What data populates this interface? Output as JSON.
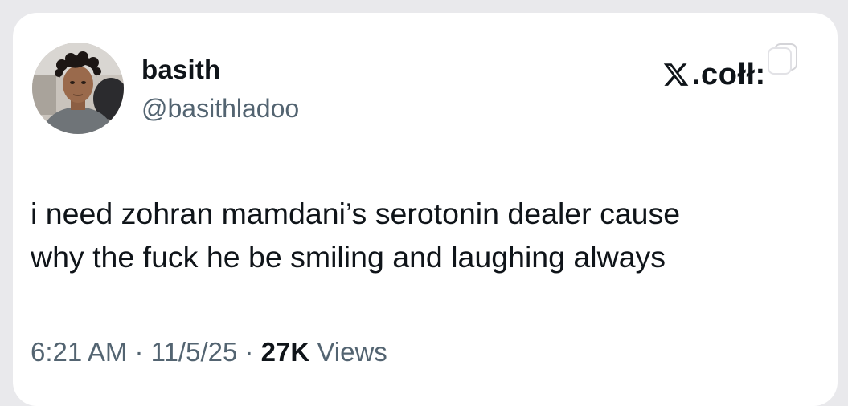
{
  "tweet": {
    "author": {
      "display_name": "basith",
      "handle": "@basithladoo",
      "avatar_icon": "profile-photo"
    },
    "brand": {
      "logo_icon": "x-logo-icon",
      "text": ".cołł:"
    },
    "text_lines": [
      "i need zohran mamdani’s serotonin dealer cause",
      "why the fuck he be smiling and laughing always"
    ],
    "meta": {
      "time": "6:21 AM",
      "separator": " · ",
      "date": "11/5/25",
      "views_count": "27K",
      "views_label": " Views"
    }
  },
  "colors": {
    "background": "#e9e9ec",
    "card": "#ffffff",
    "primary_text": "#0f1419",
    "secondary_text": "#536471"
  }
}
